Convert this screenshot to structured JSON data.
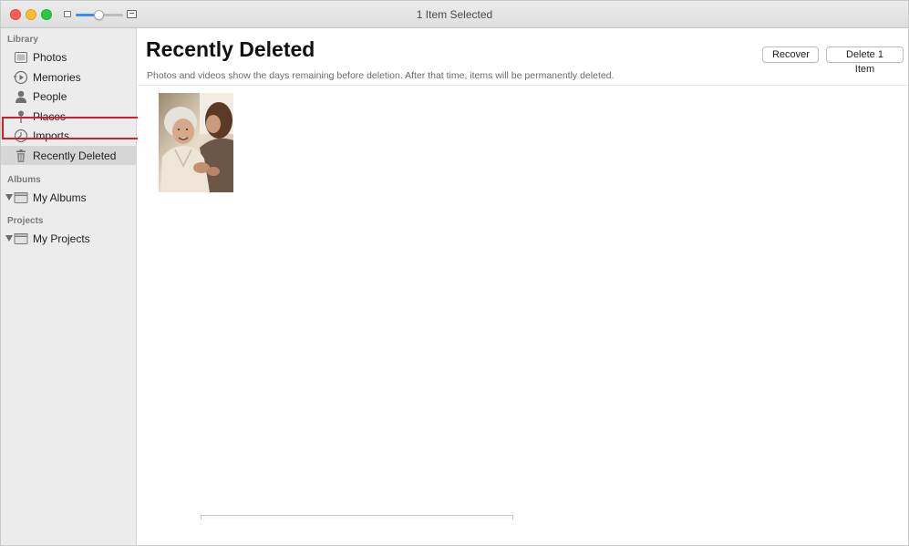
{
  "window": {
    "title": "1 Item Selected"
  },
  "zoom": {
    "level": 0.5
  },
  "sidebar": {
    "sections": {
      "library": "Library",
      "albums": "Albums",
      "projects": "Projects"
    },
    "library_items": [
      {
        "label": "Photos",
        "icon": "photos-icon"
      },
      {
        "label": "Memories",
        "icon": "memories-icon"
      },
      {
        "label": "People",
        "icon": "people-icon"
      },
      {
        "label": "Places",
        "icon": "places-icon"
      },
      {
        "label": "Imports",
        "icon": "imports-icon"
      },
      {
        "label": "Recently Deleted",
        "icon": "trash-icon"
      }
    ],
    "albums_item": {
      "label": "My Albums"
    },
    "projects_item": {
      "label": "My Projects"
    },
    "selected": "Recently Deleted"
  },
  "main": {
    "title": "Recently Deleted",
    "subtitle": "Photos and videos show the days remaining before deletion. After that time, items will be permanently deleted.",
    "buttons": {
      "recover": "Recover",
      "delete": "Delete 1 Item"
    }
  },
  "colors": {
    "highlight": "#d32026",
    "slider_accent": "#3b8ef6"
  }
}
